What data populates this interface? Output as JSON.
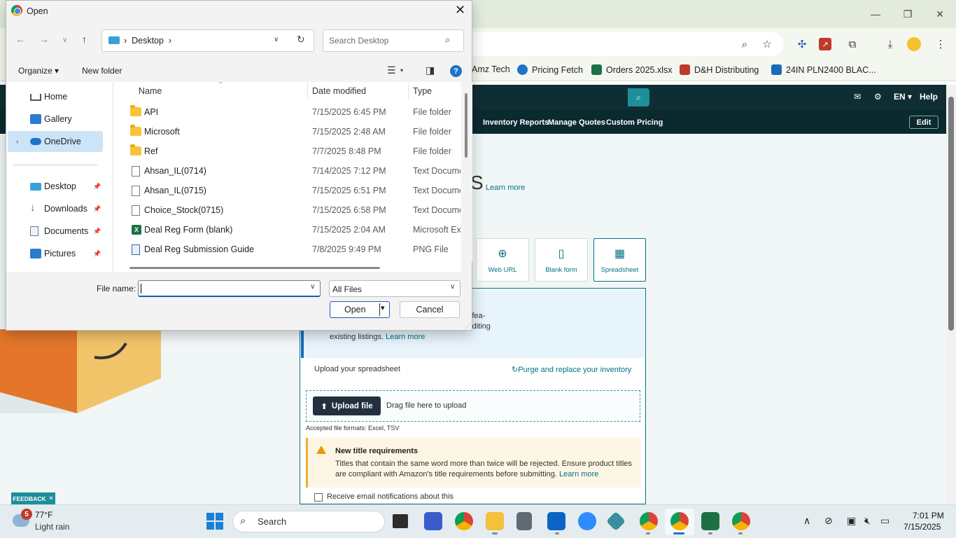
{
  "browser": {
    "window_controls": {
      "minimize": "—",
      "restore": "❐",
      "close": "✕"
    },
    "bookmarks": [
      {
        "label": "Amz Tech",
        "color": "#ffffff"
      },
      {
        "label": "Pricing Fetch",
        "color": "#1e73c8"
      },
      {
        "label": "Orders 2025.xlsx",
        "color": "#1d7044"
      },
      {
        "label": "D&H Distributing",
        "color": "#c0392b"
      },
      {
        "label": "24IN PLN2400 BLAC...",
        "color": "#1a6ab8"
      }
    ]
  },
  "amazon": {
    "nav_right": {
      "lang": "EN",
      "help": "Help"
    },
    "subnav": [
      "Inventory Reports",
      "Manage Quotes",
      "Custom Pricing"
    ],
    "edit_label": "Edit",
    "heading_tail": "S",
    "learn_more": "Learn more",
    "options": [
      {
        "label": "Web URL",
        "icon": "globe-icon"
      },
      {
        "label": "Blank form",
        "icon": "document-icon"
      },
      {
        "label": "Spreadsheet",
        "icon": "spreadsheet-icon"
      }
    ],
    "info_text": "rmat - AI will convert it for you. Note: This fea-\nyou can group while reviewing drafts) or editing\nexisting listings.",
    "info_learn": "Learn more",
    "upload_label": "Upload your spreadsheet",
    "purge_link": "Purge and replace your inventory",
    "upload_button": "Upload file",
    "drag_text": "Drag file here to upload",
    "accepted": "Accepted file formats: Excel, TSV",
    "warn_title": "New title requirements",
    "warn_text": "Titles that contain the same word more than twice will be rejected. Ensure product titles are compliant with Amazon's title requirements before submitting.",
    "warn_learn": "Learn more",
    "email_text": "Receive email notifications about this",
    "feedback": "FEEDBACK"
  },
  "dialog": {
    "title": "Open",
    "address": {
      "location": "Desktop",
      "separator": "›"
    },
    "search_placeholder": "Search Desktop",
    "organize": "Organize",
    "new_folder": "New folder",
    "nav_items": [
      {
        "label": "Home",
        "pinned": false
      },
      {
        "label": "Gallery",
        "pinned": false
      },
      {
        "label": "OneDrive",
        "pinned": false,
        "selected": true
      },
      {
        "label": "Desktop",
        "pinned": true
      },
      {
        "label": "Downloads",
        "pinned": true
      },
      {
        "label": "Documents",
        "pinned": true
      },
      {
        "label": "Pictures",
        "pinned": true
      }
    ],
    "columns": {
      "name": "Name",
      "date": "Date modified",
      "type": "Type"
    },
    "files": [
      {
        "name": "API",
        "date": "7/15/2025 6:45 PM",
        "type": "File folder",
        "kind": "folder"
      },
      {
        "name": "Microsoft",
        "date": "7/15/2025 2:48 AM",
        "type": "File folder",
        "kind": "folder"
      },
      {
        "name": "Ref",
        "date": "7/7/2025 8:48 PM",
        "type": "File folder",
        "kind": "folder"
      },
      {
        "name": "Ahsan_IL(0714)",
        "date": "7/14/2025 7:12 PM",
        "type": "Text Document",
        "kind": "text"
      },
      {
        "name": "Ahsan_IL(0715)",
        "date": "7/15/2025 6:51 PM",
        "type": "Text Document",
        "kind": "text"
      },
      {
        "name": "Choice_Stock(0715)",
        "date": "7/15/2025 6:58 PM",
        "type": "Text Document",
        "kind": "text"
      },
      {
        "name": "Deal Reg Form (blank)",
        "date": "7/15/2025 2:04 AM",
        "type": "Microsoft Excel",
        "kind": "excel"
      },
      {
        "name": "Deal Reg Submission Guide",
        "date": "7/8/2025 9:49 PM",
        "type": "PNG File",
        "kind": "png"
      }
    ],
    "file_name_label": "File name:",
    "file_name_value": "",
    "filter": "All Files",
    "open_button": "Open",
    "cancel_button": "Cancel"
  },
  "taskbar": {
    "weather_badge": "5",
    "weather_temp": "77°F",
    "weather_desc": "Light rain",
    "search_label": "Search",
    "time": "7:01 PM",
    "date": "7/15/2025"
  }
}
